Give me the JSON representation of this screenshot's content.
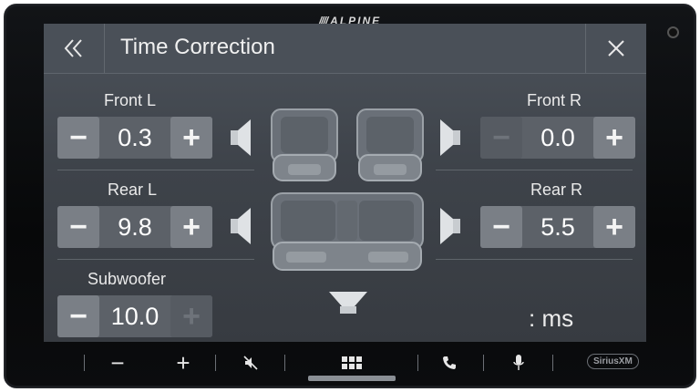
{
  "device": {
    "brand": "ALPINE"
  },
  "header": {
    "title": "Time Correction",
    "back_icon": "double-chevron-left-icon",
    "close_icon": "close-icon"
  },
  "channels": {
    "front_l": {
      "label": "Front L",
      "value": "0.3"
    },
    "front_r": {
      "label": "Front R",
      "value": "0.0"
    },
    "rear_l": {
      "label": "Rear L",
      "value": "9.8"
    },
    "rear_r": {
      "label": "Rear R",
      "value": "5.5"
    },
    "subwoofer": {
      "label": "Subwoofer",
      "value": "10.0"
    }
  },
  "controls": {
    "minus": "−",
    "plus": "+"
  },
  "unit": ": ms",
  "bottom_bar": {
    "vol_down": "−",
    "vol_up": "+",
    "sxm_logo": "SiriusXM",
    "icons": [
      "mute-icon",
      "home-grid-icon",
      "phone-icon",
      "microphone-icon"
    ]
  },
  "colors": {
    "screen_bg": "#42474e",
    "button_bg": "#7a7f86",
    "text": "#ffffff"
  }
}
